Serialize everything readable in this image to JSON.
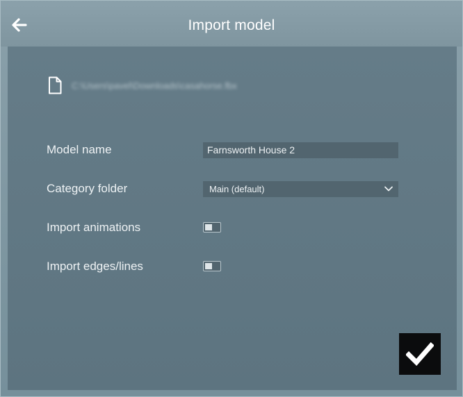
{
  "header": {
    "title": "Import model",
    "back_icon": "arrow-left-icon"
  },
  "file": {
    "icon": "file-icon",
    "path": "C:\\Users\\pavel\\Downloads\\casahorse.fbx"
  },
  "form": {
    "model_name_label": "Model name",
    "model_name_value": "Farnsworth House 2",
    "category_label": "Category folder",
    "category_value": "Main (default)",
    "import_animations_label": "Import animations",
    "import_animations_enabled": false,
    "import_edges_label": "Import edges/lines",
    "import_edges_enabled": false
  },
  "actions": {
    "confirm_icon": "checkmark-icon"
  },
  "colors": {
    "titlebar": "#8199a3",
    "panel": "#617884",
    "field": "#52656f",
    "confirm_button": "#0b0c0d"
  }
}
